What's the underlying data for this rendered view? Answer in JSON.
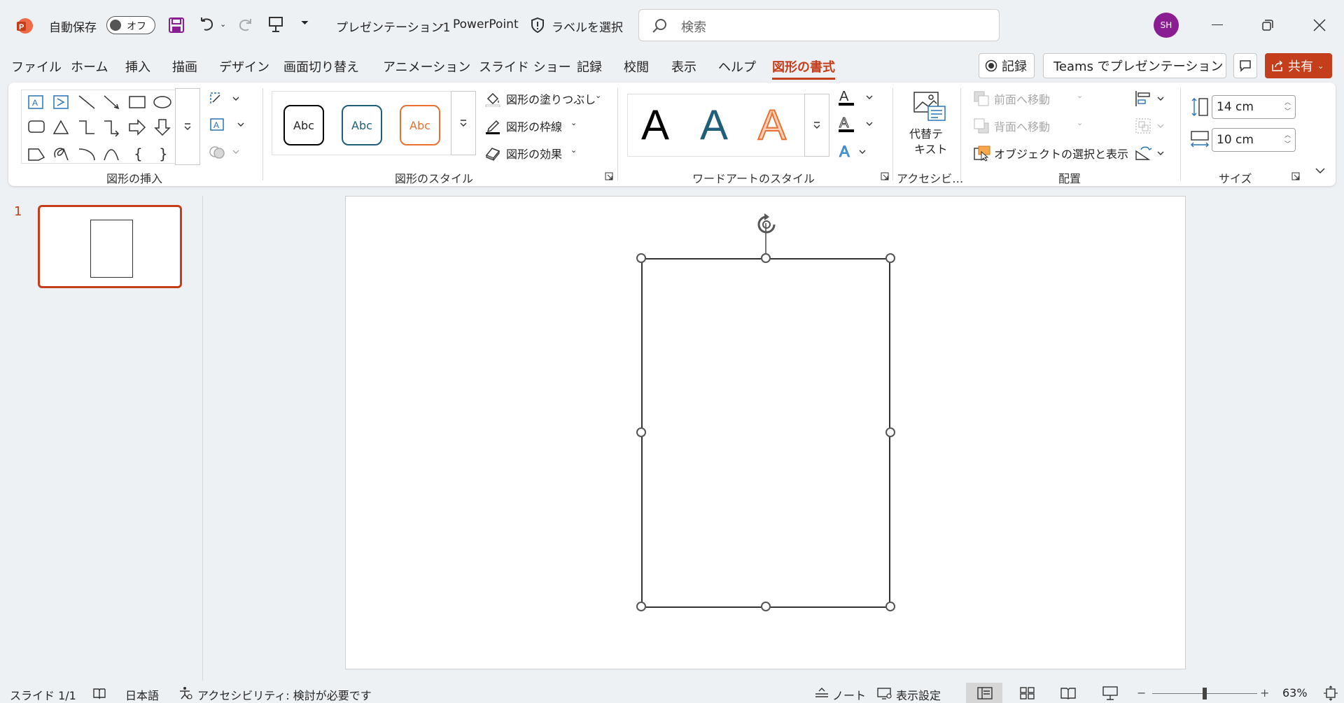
{
  "titlebar": {
    "autosave_label": "自動保存",
    "autosave_state": "オフ",
    "doc_title": "プレゼンテーション1",
    "separator": "-",
    "app_name": "PowerPoint",
    "sensitivity_label": "ラベルを選択",
    "search_placeholder": "検索",
    "user_initials": "SH"
  },
  "menu": {
    "tabs": [
      "ファイル",
      "ホーム",
      "挿入",
      "描画",
      "デザイン",
      "画面切り替え",
      "アニメーション",
      "スライド ショー",
      "記録",
      "校閲",
      "表示",
      "ヘルプ",
      "図形の書式"
    ],
    "active_tab": "図形の書式",
    "record_button": "記録",
    "teams_button": "Teams でプレゼンテーション",
    "share_button": "共有"
  },
  "ribbon": {
    "groups": {
      "insert_shapes": "図形の挿入",
      "shape_styles": "図形のスタイル",
      "wordart_styles": "ワードアートのスタイル",
      "accessibility": "アクセシビ…",
      "arrange": "配置",
      "size": "サイズ"
    },
    "style_samples": [
      "Abc",
      "Abc",
      "Abc"
    ],
    "shape_fill": "図形の塗りつぶし",
    "shape_outline": "図形の枠線",
    "shape_effects": "図形の効果",
    "wordart_samples": [
      "A",
      "A",
      "A"
    ],
    "alt_text": [
      "代替テ",
      "キスト"
    ],
    "bring_forward": "前面へ移動",
    "send_backward": "背面へ移動",
    "selection_pane": "オブジェクトの選択と表示",
    "height_value": "14 cm",
    "width_value": "10 cm"
  },
  "thumbnails": {
    "slide_number": "1"
  },
  "statusbar": {
    "slide_info": "スライド 1/1",
    "language": "日本語",
    "accessibility": "アクセシビリティ: 検討が必要です",
    "notes": "ノート",
    "display_settings": "表示設定",
    "zoom_minus": "−",
    "zoom_plus": "+",
    "zoom_level": "63%",
    "zoom_fraction": 0.5
  },
  "colors": {
    "accent": "#c43e1c",
    "style_dark": "#000000",
    "style_blue": "#1f5f7a",
    "style_orange": "#e97132",
    "avatar": "#8b1d93"
  }
}
